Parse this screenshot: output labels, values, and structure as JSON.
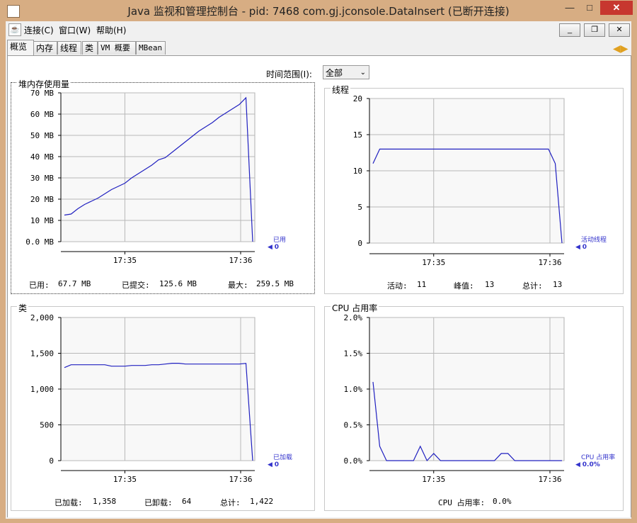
{
  "window": {
    "title": "Java 监视和管理控制台 - pid: 7468 com.gj.jconsole.DataInsert (已断开连接)",
    "min": "—",
    "max": "□",
    "close": "✕"
  },
  "menu": {
    "connect": "连接(C)",
    "window": "窗口(W)",
    "help": "帮助(H)",
    "mdi_min": "_",
    "mdi_restore": "❐",
    "mdi_close": "✕"
  },
  "tabs": [
    "概览",
    "内存",
    "线程",
    "类",
    "VM 概要",
    "MBean"
  ],
  "range": {
    "label": "时间范围(I):",
    "value": "全部"
  },
  "panels": {
    "heap": {
      "title": "堆内存使用量",
      "legend_name": "已用",
      "legend_value": "0",
      "stats": {
        "used_label": "已用:",
        "used": "67.7 MB",
        "committed_label": "已提交:",
        "committed": "125.6 MB",
        "max_label": "最大:",
        "max": "259.5 MB"
      }
    },
    "threads": {
      "title": "线程",
      "legend_name": "活动线程",
      "legend_value": "0",
      "stats": {
        "live_label": "活动:",
        "live": "11",
        "peak_label": "峰值:",
        "peak": "13",
        "total_label": "总计:",
        "total": "13"
      }
    },
    "classes": {
      "title": "类",
      "legend_name": "已加载",
      "legend_value": "0",
      "stats": {
        "loaded_label": "已加载:",
        "loaded": "1,358",
        "unloaded_label": "已卸载:",
        "unloaded": "64",
        "total_label": "总计:",
        "total": "1,422"
      }
    },
    "cpu": {
      "title": "CPU 占用率",
      "legend_name": "CPU 占用率",
      "legend_value": "0.0%",
      "stats": {
        "cpu_label": "CPU 占用率:",
        "cpu": "0.0%"
      }
    }
  },
  "chart_data": [
    {
      "type": "line",
      "title": "堆内存使用量",
      "x_ticks": [
        "17:35",
        "17:36"
      ],
      "y_ticks": [
        "0.0 MB",
        "10 MB",
        "20 MB",
        "30 MB",
        "40 MB",
        "50 MB",
        "60 MB",
        "70 MB"
      ],
      "ylim": [
        0,
        70
      ],
      "color": "#2020c0",
      "series": [
        {
          "name": "已用",
          "values": [
            12.5,
            13,
            15.5,
            17.5,
            19,
            20.5,
            22.5,
            24.5,
            26,
            27.5,
            30,
            32,
            34,
            36,
            38.5,
            39.5,
            42,
            44.5,
            47,
            49.5,
            52,
            54,
            56,
            58.5,
            60.5,
            62.5,
            64.5,
            67.7,
            0
          ]
        }
      ]
    },
    {
      "type": "line",
      "title": "线程",
      "x_ticks": [
        "17:35",
        "17:36"
      ],
      "y_ticks": [
        "0",
        "5",
        "10",
        "15",
        "20"
      ],
      "ylim": [
        0,
        20
      ],
      "color": "#2020c0",
      "series": [
        {
          "name": "活动线程",
          "values": [
            11,
            13,
            13,
            13,
            13,
            13,
            13,
            13,
            13,
            13,
            13,
            13,
            13,
            13,
            13,
            13,
            13,
            13,
            13,
            13,
            13,
            13,
            13,
            13,
            13,
            13,
            13,
            11,
            0
          ]
        }
      ]
    },
    {
      "type": "line",
      "title": "类",
      "x_ticks": [
        "17:35",
        "17:36"
      ],
      "y_ticks": [
        "0",
        "500",
        "1,000",
        "1,500",
        "2,000"
      ],
      "ylim": [
        0,
        2000
      ],
      "color": "#2020c0",
      "series": [
        {
          "name": "已加载",
          "values": [
            1300,
            1340,
            1340,
            1340,
            1340,
            1340,
            1340,
            1320,
            1320,
            1320,
            1330,
            1330,
            1330,
            1340,
            1340,
            1350,
            1360,
            1360,
            1350,
            1350,
            1350,
            1350,
            1350,
            1350,
            1350,
            1350,
            1350,
            1358,
            0
          ]
        }
      ]
    },
    {
      "type": "line",
      "title": "CPU 占用率",
      "x_ticks": [
        "17:35",
        "17:36"
      ],
      "y_ticks": [
        "0.0%",
        "0.5%",
        "1.0%",
        "1.5%",
        "2.0%"
      ],
      "ylim": [
        0,
        2.0
      ],
      "color": "#2020c0",
      "series": [
        {
          "name": "CPU 占用率",
          "values": [
            1.1,
            0.2,
            0,
            0,
            0,
            0,
            0,
            0.2,
            0,
            0.1,
            0,
            0,
            0,
            0,
            0,
            0,
            0,
            0,
            0,
            0.1,
            0.1,
            0,
            0,
            0,
            0,
            0,
            0,
            0,
            0
          ]
        }
      ]
    }
  ]
}
